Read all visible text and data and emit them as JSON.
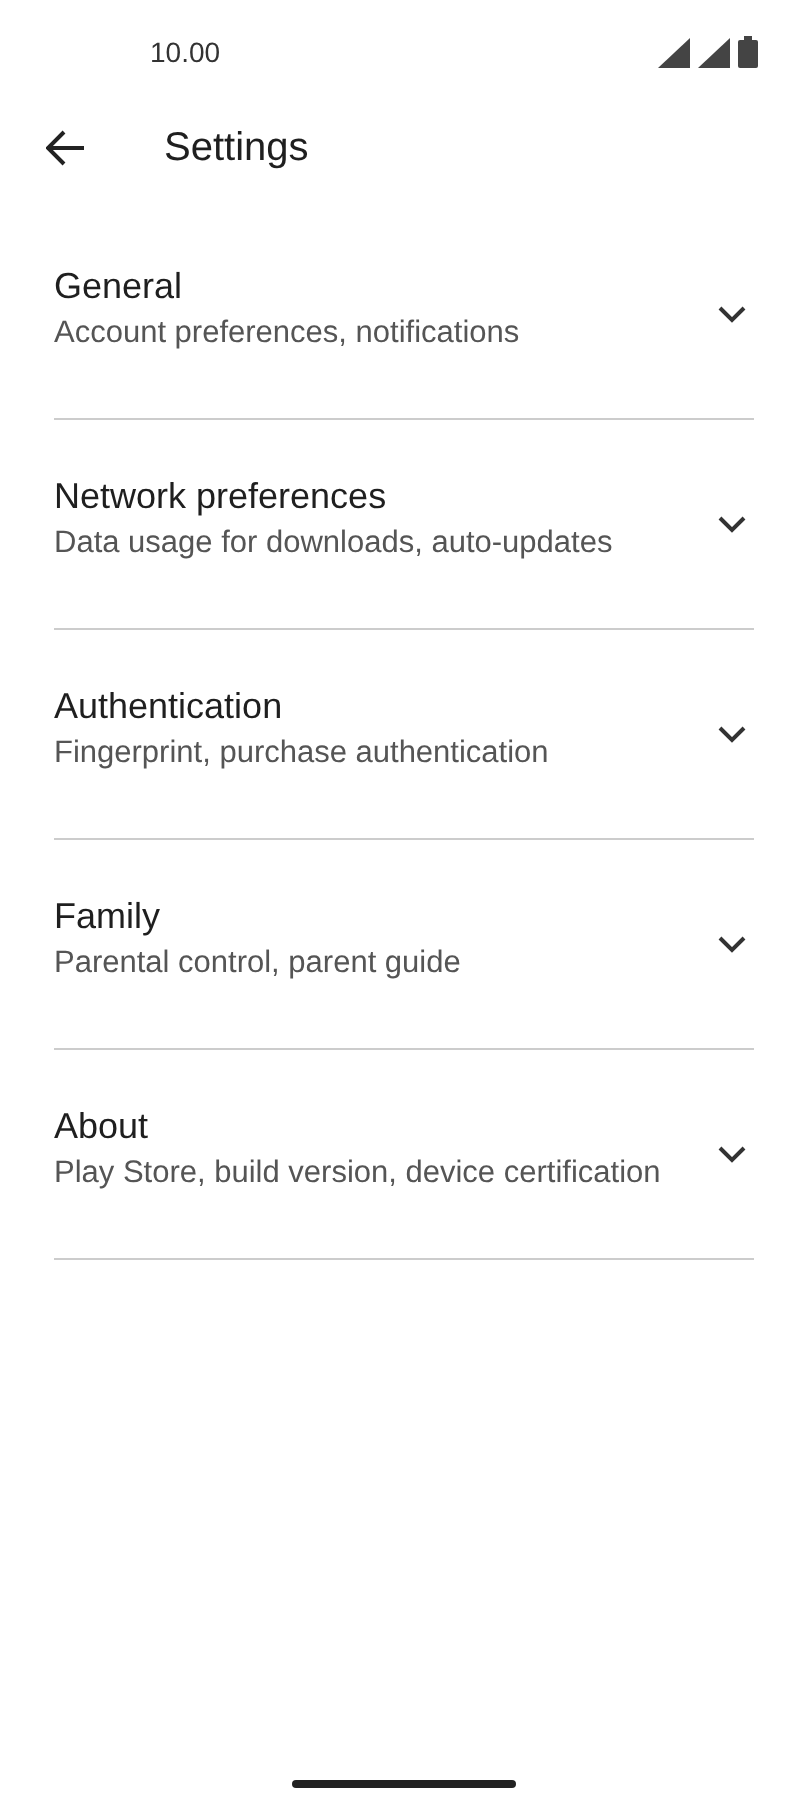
{
  "status_bar": {
    "time": "10.00"
  },
  "header": {
    "title": "Settings"
  },
  "sections": [
    {
      "title": "General",
      "subtitle": "Account preferences, notifications",
      "expanded": false
    },
    {
      "title": "Network preferences",
      "subtitle": "Data usage for downloads, auto-updates",
      "expanded": false
    },
    {
      "title": "Authentication",
      "subtitle": "Fingerprint, purchase authentication",
      "expanded": false
    },
    {
      "title": "Family",
      "subtitle": "Parental control, parent guide",
      "expanded": false
    },
    {
      "title": "About",
      "subtitle": "Play Store, build version, device certification",
      "expanded": false
    }
  ]
}
